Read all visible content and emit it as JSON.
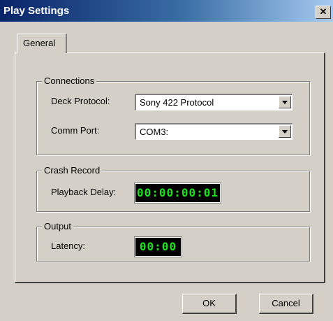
{
  "window": {
    "title": "Play Settings",
    "close_glyph": "✕"
  },
  "tabs": [
    {
      "label": "General",
      "selected": true
    }
  ],
  "connections": {
    "legend": "Connections",
    "deck_protocol": {
      "label": "Deck Protocol:",
      "value": "Sony 422 Protocol"
    },
    "comm_port": {
      "label": "Comm Port:",
      "value": "COM3:"
    }
  },
  "crash_record": {
    "legend": "Crash Record",
    "playback_delay": {
      "label": "Playback Delay:",
      "value": "00:00:00:01"
    }
  },
  "output": {
    "legend": "Output",
    "latency": {
      "label": "Latency:",
      "value": "00:00"
    }
  },
  "buttons": {
    "ok": "OK",
    "cancel": "Cancel"
  },
  "colors": {
    "lcd_text": "#1fe01f",
    "lcd_bg": "#000000",
    "titlebar_start": "#0a246a",
    "titlebar_end": "#a6caf0"
  }
}
